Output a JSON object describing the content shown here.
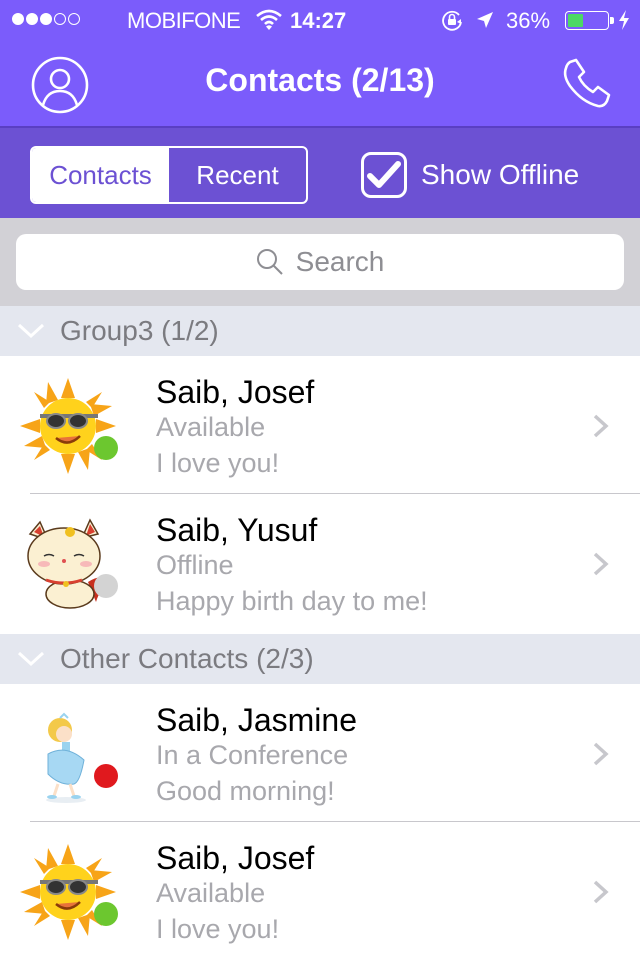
{
  "status_bar": {
    "signal_filled": 3,
    "signal_total": 5,
    "carrier": "MOBIFONE",
    "time": "14:27",
    "battery_percent_label": "36%",
    "battery_level": 0.36,
    "icons": [
      "wifi-icon",
      "rotation-lock-icon",
      "location-arrow-icon",
      "battery-icon",
      "charging-bolt-icon"
    ],
    "battery_color": "#4cd964"
  },
  "nav": {
    "title": "Contacts (2/13)",
    "left_icon": "profile-icon",
    "right_icon": "phone-icon",
    "background": "#7b5cfb"
  },
  "filter": {
    "segments": [
      {
        "label": "Contacts",
        "active": true
      },
      {
        "label": "Recent",
        "active": false
      }
    ],
    "show_offline": {
      "label": "Show Offline",
      "checked": true
    },
    "background": "#6c51d3"
  },
  "search": {
    "placeholder": "Search",
    "value": ""
  },
  "groups": [
    {
      "label": "Group3 (1/2)",
      "expanded": true,
      "contacts": [
        {
          "name": "Saib, Josef",
          "status": "Available",
          "mood": "I love you!",
          "avatar": "sun-sunglasses-avatar",
          "presence": "available",
          "presence_color": "#6cc72f"
        },
        {
          "name": "Saib, Yusuf",
          "status": "Offline",
          "mood": "Happy birth day to me!",
          "avatar": "lucky-cat-avatar",
          "presence": "offline",
          "presence_color": "#d3d3d3"
        }
      ]
    },
    {
      "label": "Other Contacts (2/3)",
      "expanded": true,
      "contacts": [
        {
          "name": "Saib, Jasmine",
          "status": "In a Conference",
          "mood": "Good morning!",
          "avatar": "princess-avatar",
          "presence": "busy",
          "presence_color": "#e0191e"
        },
        {
          "name": "Saib, Josef",
          "status": "Available",
          "mood": "I love you!",
          "avatar": "sun-sunglasses-avatar",
          "presence": "available",
          "presence_color": "#6cc72f"
        }
      ]
    }
  ]
}
